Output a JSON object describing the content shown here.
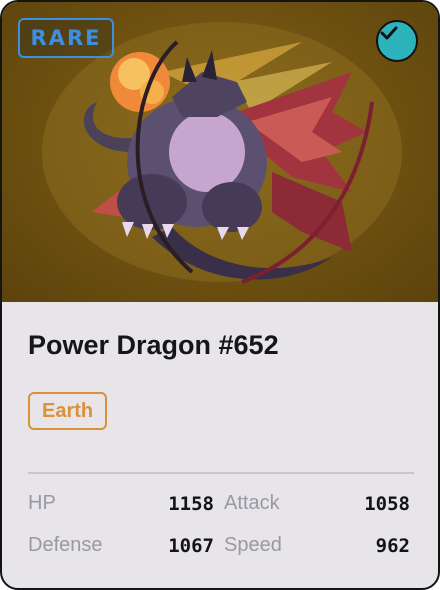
{
  "card": {
    "rarity": "RARE",
    "name": "Power Dragon #652",
    "type": "Earth",
    "verified_icon": "check-icon",
    "stats": [
      {
        "label": "HP",
        "value": "1158"
      },
      {
        "label": "Attack",
        "value": "1058"
      },
      {
        "label": "Defense",
        "value": "1067"
      },
      {
        "label": "Speed",
        "value": "962"
      }
    ]
  },
  "colors": {
    "rarity": "#3d8fe0",
    "type": "#d9913a",
    "verified": "#2db3bb",
    "art_background": "#725412"
  }
}
